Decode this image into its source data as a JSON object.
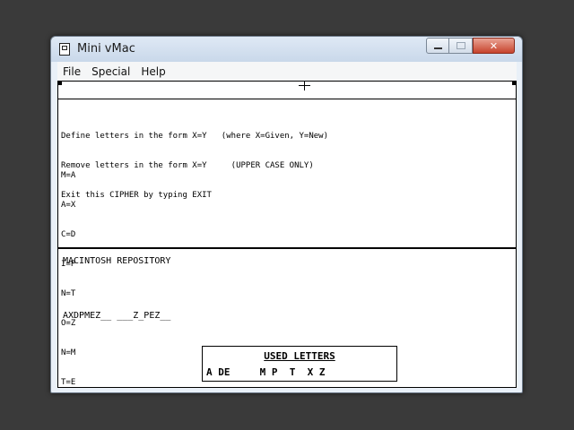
{
  "window": {
    "title": "Mini vMac",
    "close_glyph": "✕"
  },
  "menu": [
    "File",
    "Special",
    "Help"
  ],
  "instructions": [
    "Define letters in the form X=Y   (where X=Given, Y=New)",
    "Remove letters in the form X=Y     (UPPER CASE ONLY)",
    "Exit this CIPHER by typing EXIT"
  ],
  "mappings": [
    "M=A",
    "A=X",
    "C=D",
    "I=P",
    "N=T",
    "O=Z",
    "N=M",
    "T=E"
  ],
  "plaintext": "MACINTOSH REPOSITORY",
  "ciphertext": "AXDPMEZ__ ___Z_PEZ__",
  "used_letters": {
    "title": "USED LETTERS",
    "letters": "A DE     M P  T  X Z"
  }
}
